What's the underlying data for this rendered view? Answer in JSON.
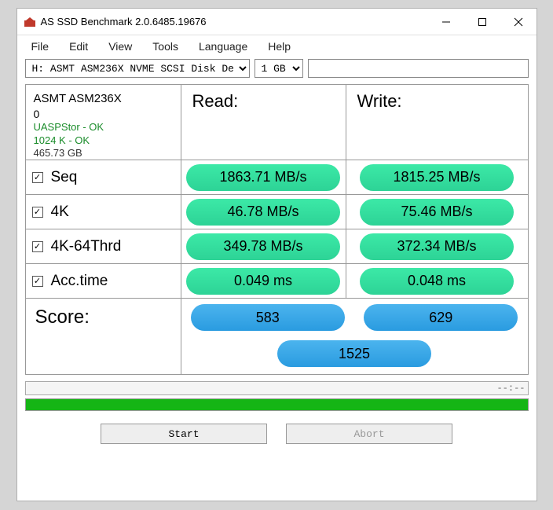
{
  "window": {
    "title": "AS SSD Benchmark 2.0.6485.19676"
  },
  "menu": {
    "file": "File",
    "edit": "Edit",
    "view": "View",
    "tools": "Tools",
    "language": "Language",
    "help": "Help"
  },
  "toolbar": {
    "disk": "H: ASMT ASM236X NVME SCSI Disk De",
    "size": "1 GB",
    "text": ""
  },
  "info": {
    "name": "ASMT ASM236X",
    "rev": "0",
    "driver": "UASPStor - OK",
    "align": "1024 K - OK",
    "capacity": "465.73 GB"
  },
  "headers": {
    "read": "Read:",
    "write": "Write:"
  },
  "rows": {
    "seq": {
      "label": "Seq",
      "read": "1863.71 MB/s",
      "write": "1815.25 MB/s"
    },
    "k4": {
      "label": "4K",
      "read": "46.78 MB/s",
      "write": "75.46 MB/s"
    },
    "k4t": {
      "label": "4K-64Thrd",
      "read": "349.78 MB/s",
      "write": "372.34 MB/s"
    },
    "acc": {
      "label": "Acc.time",
      "read": "0.049 ms",
      "write": "0.048 ms"
    }
  },
  "score": {
    "label": "Score:",
    "read": "583",
    "write": "629",
    "total": "1525"
  },
  "progress": {
    "text": "--:--"
  },
  "buttons": {
    "start": "Start",
    "abort": "Abort"
  },
  "chart_data": {
    "type": "table",
    "title": "AS SSD Benchmark",
    "device": "ASMT ASM236X",
    "capacity_gb": 465.73,
    "test_size": "1 GB",
    "series": [
      {
        "name": "Seq",
        "read_MBps": 1863.71,
        "write_MBps": 1815.25
      },
      {
        "name": "4K",
        "read_MBps": 46.78,
        "write_MBps": 75.46
      },
      {
        "name": "4K-64Thrd",
        "read_MBps": 349.78,
        "write_MBps": 372.34
      },
      {
        "name": "Acc.time",
        "read_ms": 0.049,
        "write_ms": 0.048
      }
    ],
    "score": {
      "read": 583,
      "write": 629,
      "total": 1525
    }
  }
}
